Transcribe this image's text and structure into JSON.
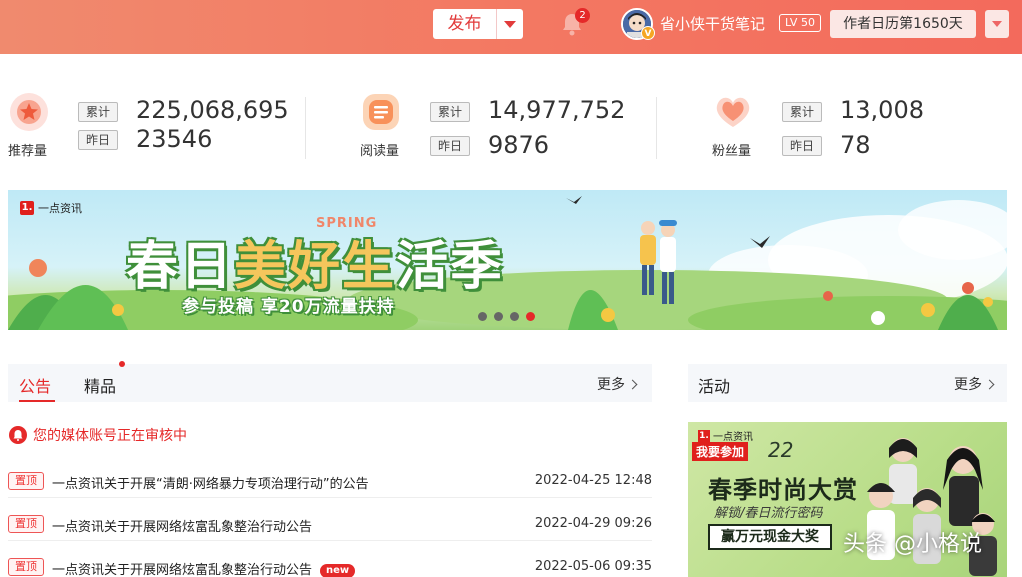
{
  "header": {
    "publish_label": "发布",
    "notification_count": "2",
    "avatar_badge": "V",
    "username": "省小侠干货笔记",
    "level": "LV 50",
    "author_days": "作者日历第1650天"
  },
  "stats": [
    {
      "label": "推荐量",
      "icon": "recommend-icon",
      "total_tag": "累计",
      "total": "225,068,695",
      "yesterday_tag": "昨日",
      "yesterday": "23546"
    },
    {
      "label": "阅读量",
      "icon": "read-icon",
      "total_tag": "累计",
      "total": "14,977,752",
      "yesterday_tag": "昨日",
      "yesterday": "9876"
    },
    {
      "label": "粉丝量",
      "icon": "fans-icon",
      "total_tag": "累计",
      "total": "13,008",
      "yesterday_tag": "昨日",
      "yesterday": "78"
    }
  ],
  "banner": {
    "logo": "一点资讯",
    "logo_mark": "1.",
    "spring": "SPRING",
    "title_a": "春日",
    "title_b": "美好",
    "title_c": "生",
    "title_d": "活季",
    "subtitle": "参与投稿  享20万流量扶持",
    "slides": 4,
    "active_slide": 4
  },
  "announcements": {
    "tabs": [
      "公告",
      "精品"
    ],
    "more_label": "更多",
    "notice": "您的媒体账号正在审核中",
    "pin_label": "置顶",
    "new_label": "new",
    "rows": [
      {
        "title": "一点资讯关于开展“清朗·网络暴力专项治理行动”的公告",
        "date": "2022-04-25 12:48"
      },
      {
        "title": "一点资讯关于开展网络炫富乱象整治行动公告",
        "date": "2022-04-29 09:26"
      },
      {
        "title": "一点资讯关于开展网络炫富乱象整治行动公告",
        "date": "2022-05-06 09:35"
      }
    ]
  },
  "activity": {
    "title": "活动",
    "more_label": "更多",
    "logo": "一点资讯",
    "join": "我要参加",
    "num": "22",
    "headline": "春季时尚大赏",
    "sub": "解锁/春日流行密码",
    "prize": "赢万元现金大奖",
    "watermark": "头条 @小格说"
  },
  "colors": {
    "accent": "#e52929",
    "header_start": "#f08a6e",
    "header_end": "#f36a5c"
  }
}
